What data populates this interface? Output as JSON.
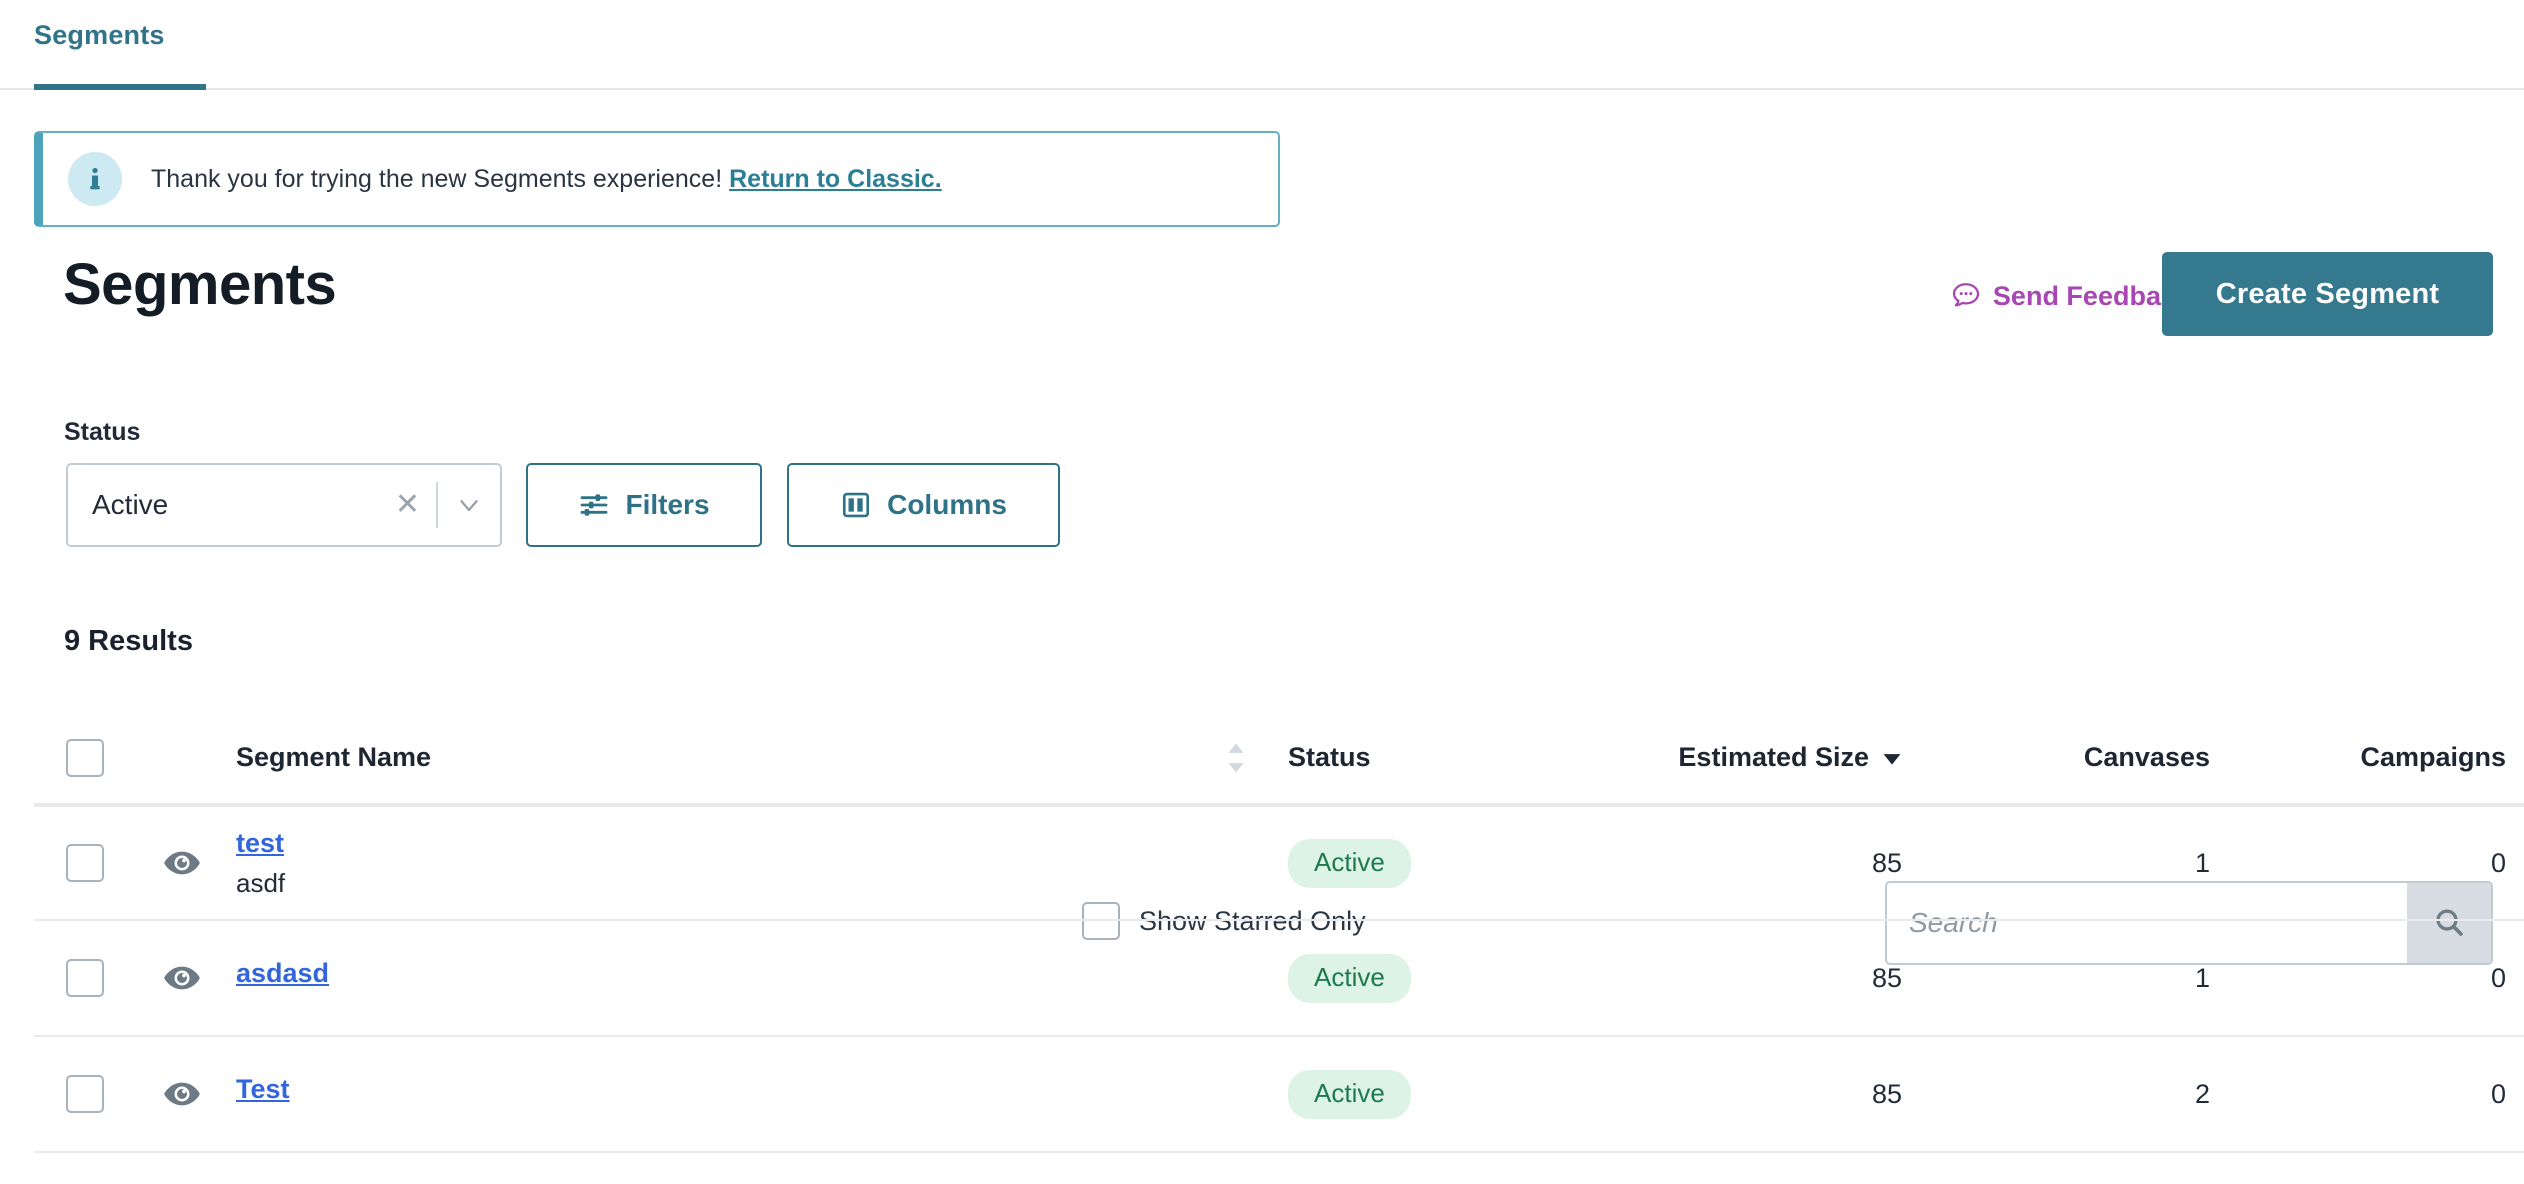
{
  "tabs": [
    {
      "label": "Segments",
      "active": true
    }
  ],
  "banner": {
    "icon": "info-icon",
    "text": "Thank you for trying the new Segments experience!",
    "link_label": "Return to Classic.",
    "accent_color": "#4da3bb",
    "icon_bg": "#cdeaf2"
  },
  "header": {
    "title": "Segments",
    "feedback_label": "Send Feedback",
    "feedback_icon": "chat-bubble-icon",
    "feedback_color": "#a846b3",
    "create_label": "Create Segment",
    "create_color": "#35798e"
  },
  "controls": {
    "status_label": "Status",
    "status_value": "Active",
    "status_clear_icon": "close-icon",
    "status_caret_icon": "chevron-down-icon",
    "filters_label": "Filters",
    "filters_icon": "sliders-icon",
    "columns_label": "Columns",
    "columns_icon": "columns-icon",
    "starred_label": "Show Starred Only",
    "starred_checked": false,
    "search_placeholder": "Search",
    "search_value": "",
    "search_icon": "search-icon"
  },
  "results": {
    "count_label": "9 Results"
  },
  "table": {
    "columns": [
      {
        "key": "name",
        "label": "Segment Name",
        "sortable": true,
        "sort": "none"
      },
      {
        "key": "status",
        "label": "Status",
        "sortable": false
      },
      {
        "key": "size",
        "label": "Estimated Size",
        "sortable": true,
        "sort": "desc"
      },
      {
        "key": "canvases",
        "label": "Canvases",
        "sortable": false
      },
      {
        "key": "campaigns",
        "label": "Campaigns",
        "sortable": false
      }
    ],
    "rows": [
      {
        "selected": false,
        "eye_icon": "eye-icon",
        "name": "test",
        "description": "asdf",
        "status": "Active",
        "estimated_size": "85",
        "canvases": "1",
        "campaigns": "0"
      },
      {
        "selected": false,
        "eye_icon": "eye-icon",
        "name": "asdasd",
        "description": "",
        "status": "Active",
        "estimated_size": "85",
        "canvases": "1",
        "campaigns": "0"
      },
      {
        "selected": false,
        "eye_icon": "eye-icon",
        "name": "Test",
        "description": "",
        "status": "Active",
        "estimated_size": "85",
        "canvases": "2",
        "campaigns": "0"
      }
    ]
  },
  "colors": {
    "teal": "#35798e",
    "tab_teal": "#31748a",
    "link_blue": "#3366dd",
    "badge_bg": "#dcf3e6",
    "badge_text": "#1e7a4c",
    "purple": "#a846b3"
  }
}
